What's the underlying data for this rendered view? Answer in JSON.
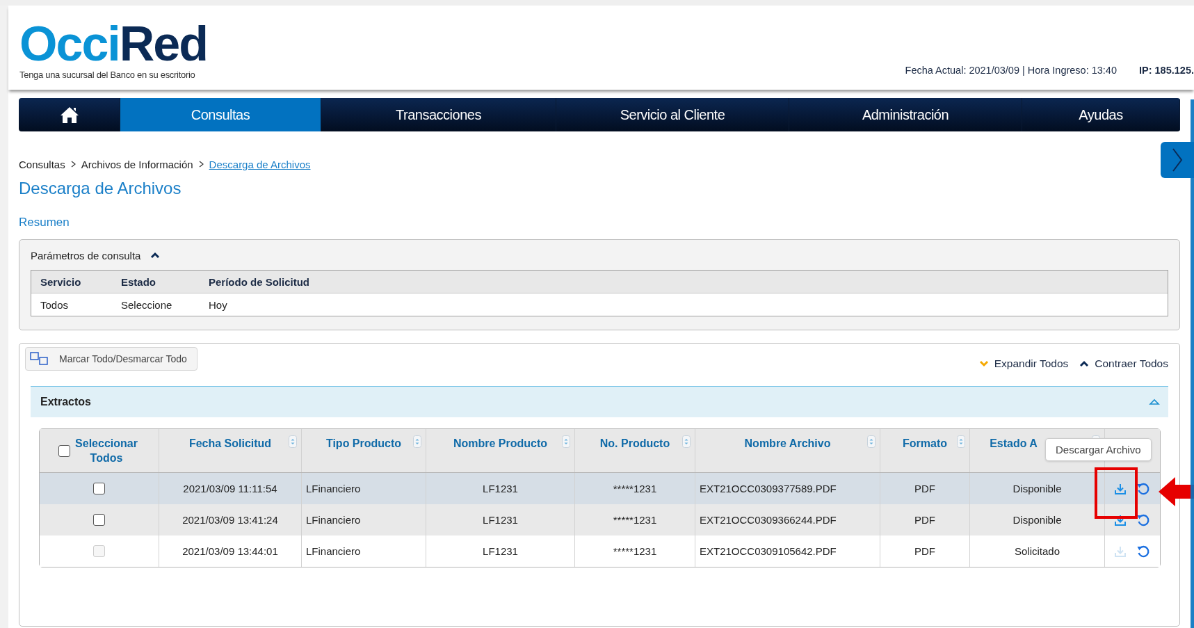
{
  "header": {
    "logo": {
      "parts": [
        "Occi",
        "Red"
      ],
      "tagline": "Tenga una sucursal del Banco en su escritorio"
    },
    "session_info": "Fecha Actual: 2021/03/09 | Hora Ingreso: 13:40",
    "ip": "IP: 185.125."
  },
  "nav": {
    "items": [
      {
        "kind": "home",
        "selected": false
      },
      {
        "kind": "text",
        "label": "Consultas",
        "selected": true
      },
      {
        "kind": "text",
        "label": "Transacciones",
        "selected": false
      },
      {
        "kind": "text",
        "label": "Servicio al Cliente",
        "selected": false
      },
      {
        "kind": "text",
        "label": "Administración",
        "selected": false
      },
      {
        "kind": "text",
        "label": "Ayudas",
        "selected": false
      }
    ]
  },
  "breadcrumb": [
    "Consultas",
    "Archivos de Información",
    "Descarga de Archivos"
  ],
  "page_title": "Descarga de Archivos",
  "section_link": "Resumen",
  "parameters": {
    "title": "Parámetros de consulta",
    "expanded": true,
    "columns": [
      "Servicio",
      "Estado",
      "Período de Solicitud"
    ],
    "values": [
      "Todos",
      "Seleccione",
      "Hoy"
    ]
  },
  "toolbar": {
    "mark_all": "Marcar Todo/Desmarcar Todo",
    "expand_all": "Expandir Todos",
    "collapse_all": "Contraer Todos"
  },
  "group": {
    "title": "Extractos",
    "expanded": true,
    "select_all": {
      "label": "Seleccionar Todos",
      "checked": false
    },
    "columns": [
      "Fecha Solicitud",
      "Tipo Producto",
      "Nombre Producto",
      "No. Producto",
      "Nombre Archivo",
      "Formato",
      "Estado A"
    ],
    "rows": [
      {
        "highlighted": true,
        "checked": false,
        "checkbox_disabled": false,
        "download_disabled": false,
        "cells": [
          "2021/03/09 11:11:54",
          "LFinanciero",
          "LF1231",
          "*****1231",
          "EXT21OCC0309377589.PDF",
          "PDF",
          "Disponible"
        ]
      },
      {
        "highlighted": false,
        "checked": false,
        "checkbox_disabled": false,
        "download_disabled": false,
        "cells": [
          "2021/03/09 13:41:24",
          "LFinanciero",
          "LF1231",
          "*****1231",
          "EXT21OCC0309366244.PDF",
          "PDF",
          "Disponible"
        ]
      },
      {
        "highlighted": false,
        "checked": false,
        "checkbox_disabled": true,
        "download_disabled": true,
        "cells": [
          "2021/03/09 13:44:01",
          "LFinanciero",
          "LF1231",
          "*****1231",
          "EXT21OCC0309105642.PDF",
          "PDF",
          "Solicitado"
        ]
      }
    ],
    "tooltip": "Descargar Archivo"
  }
}
